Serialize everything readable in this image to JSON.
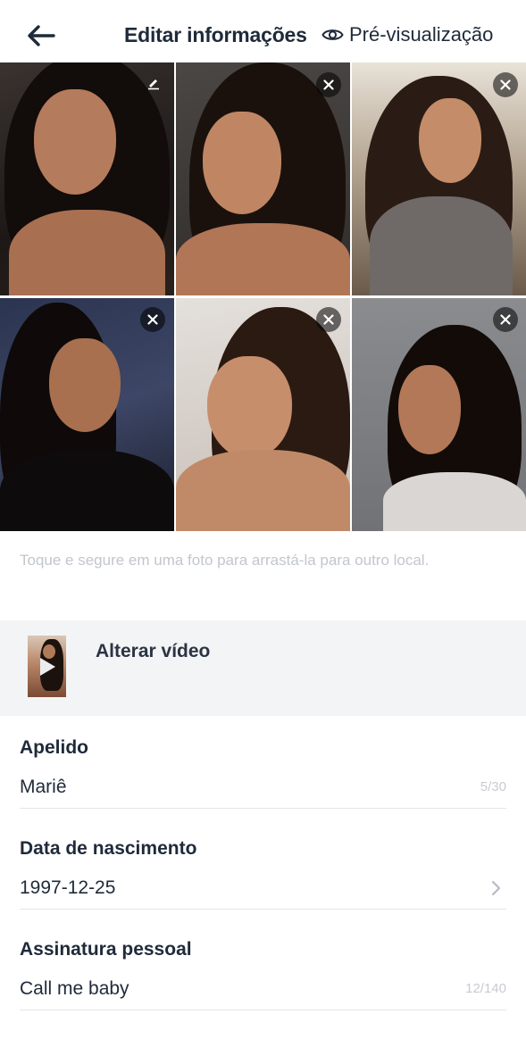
{
  "header": {
    "title": "Editar informações",
    "preview_label": "Pré-visualização"
  },
  "photos": [
    {
      "action": "edit-icon"
    },
    {
      "action": "close-icon"
    },
    {
      "action": "close-icon"
    },
    {
      "action": "close-icon"
    },
    {
      "action": "close-icon"
    },
    {
      "action": "close-icon"
    }
  ],
  "hint": "Toque e segure em uma foto para arrastá-la para outro local.",
  "video": {
    "label": "Alterar vídeo"
  },
  "fields": {
    "nickname": {
      "label": "Apelido",
      "value": "Mariê",
      "counter": "5/30"
    },
    "birthdate": {
      "label": "Data de nascimento",
      "value": "1997-12-25"
    },
    "signature": {
      "label": "Assinatura pessoal",
      "value": "Call me baby",
      "counter": "12/140"
    }
  },
  "colors": {
    "text": "#1f2a3a",
    "hint": "#c2c6cd",
    "video_row_bg": "#f3f4f6",
    "divider": "#e3e5e9"
  }
}
